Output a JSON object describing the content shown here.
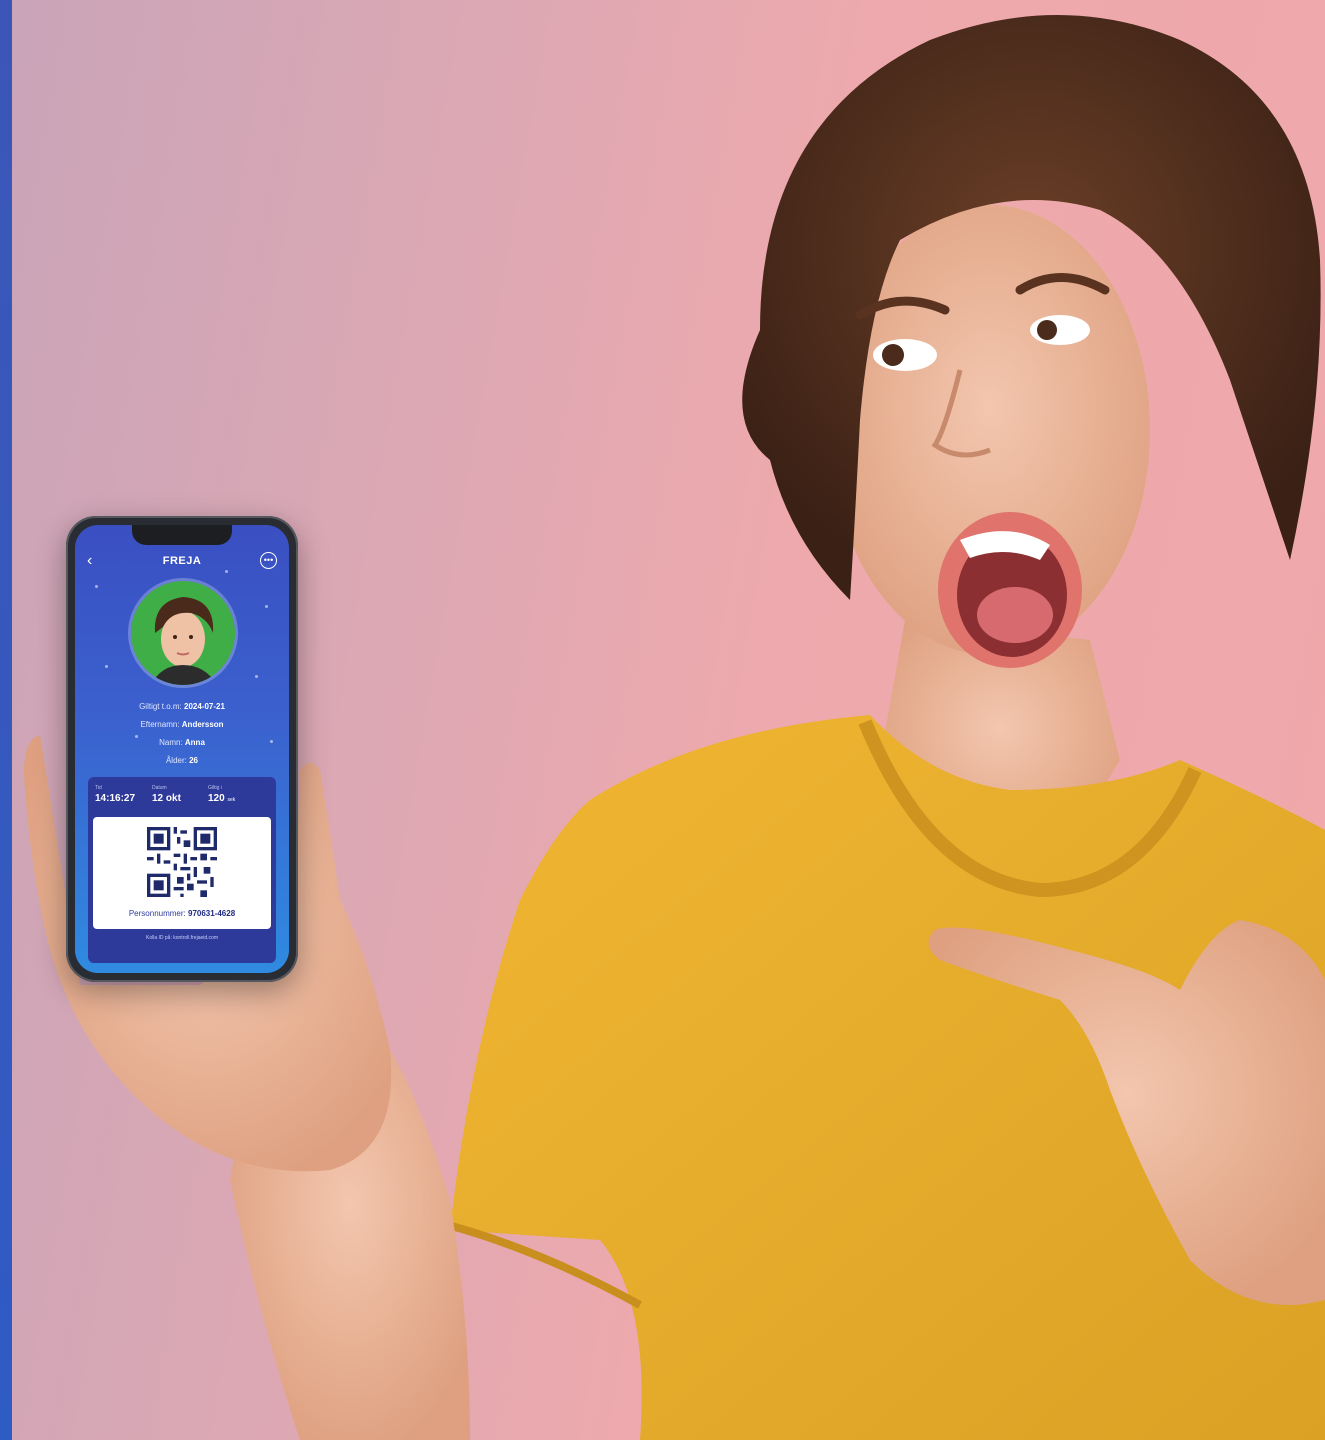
{
  "phone": {
    "app_title": "FREJA",
    "valid_until_label": "Giltigt t.o.m:",
    "valid_until_value": "2024-07-21",
    "surname_label": "Efternamn:",
    "surname_value": "Andersson",
    "name_label": "Namn:",
    "name_value": "Anna",
    "age_label": "Ålder:",
    "age_value": "26",
    "time_label": "Tid",
    "time_value": "14:16:27",
    "date_label": "Datum",
    "date_value": "12 okt",
    "valid_for_label": "Giltig i",
    "valid_for_value": "120",
    "valid_for_unit": "sek",
    "pnr_label": "Personnummer:",
    "pnr_value": "970631-4628",
    "footer": "Kolla ID på: kontroll.frejaeid.com"
  },
  "colors": {
    "background": "#eda9ad",
    "shirt": "#e8ad2e",
    "phone_screen": "#3b5ccc",
    "accent_stripe": "#3157c1"
  }
}
